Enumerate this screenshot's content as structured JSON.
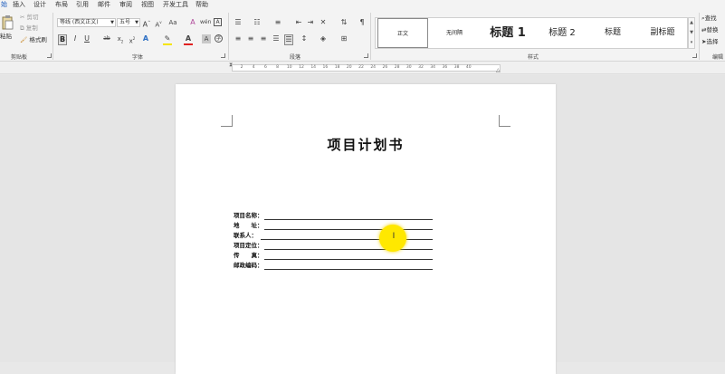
{
  "menubar": {
    "tabs": [
      "始",
      "插入",
      "设计",
      "布局",
      "引用",
      "邮件",
      "审阅",
      "视图",
      "开发工具",
      "帮助"
    ],
    "active_index": 0
  },
  "ribbon": {
    "clipboard": {
      "paste": "粘贴",
      "cut": "剪切",
      "copy": "复制",
      "format_painter": "格式刷",
      "label": "剪贴板"
    },
    "font": {
      "font_name": "等线 (西文正文)",
      "font_size": "五号",
      "label": "字体"
    },
    "paragraph": {
      "label": "段落"
    },
    "styles": {
      "label": "样式",
      "items": [
        "正文",
        "无间隔",
        "标题 1",
        "标题 2",
        "标题",
        "副标题"
      ]
    },
    "editing": {
      "find": "查找",
      "replace": "替换",
      "select": "选择",
      "label": "编辑"
    }
  },
  "ruler": {
    "numbers": [
      "2",
      "4",
      "6",
      "8",
      "10",
      "12",
      "14",
      "16",
      "18",
      "20",
      "22",
      "24",
      "26",
      "28",
      "30",
      "32",
      "34",
      "36",
      "38",
      "40"
    ]
  },
  "document": {
    "title": "项目计划书",
    "fields": [
      "项目名称：",
      "地　　址：",
      "联系人：",
      "项目定位：",
      "传　　真：",
      "邮政编码："
    ]
  },
  "icons": [
    "paste-icon",
    "cut-icon",
    "copy-icon",
    "format-painter-icon",
    "bold-icon",
    "italic-icon",
    "underline-icon",
    "strikethrough-icon",
    "subscript-icon",
    "superscript-icon",
    "font-color-icon",
    "highlight-icon",
    "bullets-icon",
    "numbering-icon",
    "align-left-icon",
    "align-center-icon",
    "align-right-icon",
    "justify-icon",
    "sort-icon",
    "show-marks-icon",
    "find-icon",
    "replace-icon",
    "select-icon",
    "text-cursor-icon"
  ],
  "colors": {
    "accent": "#185abd",
    "highlight": "#ffe800"
  }
}
